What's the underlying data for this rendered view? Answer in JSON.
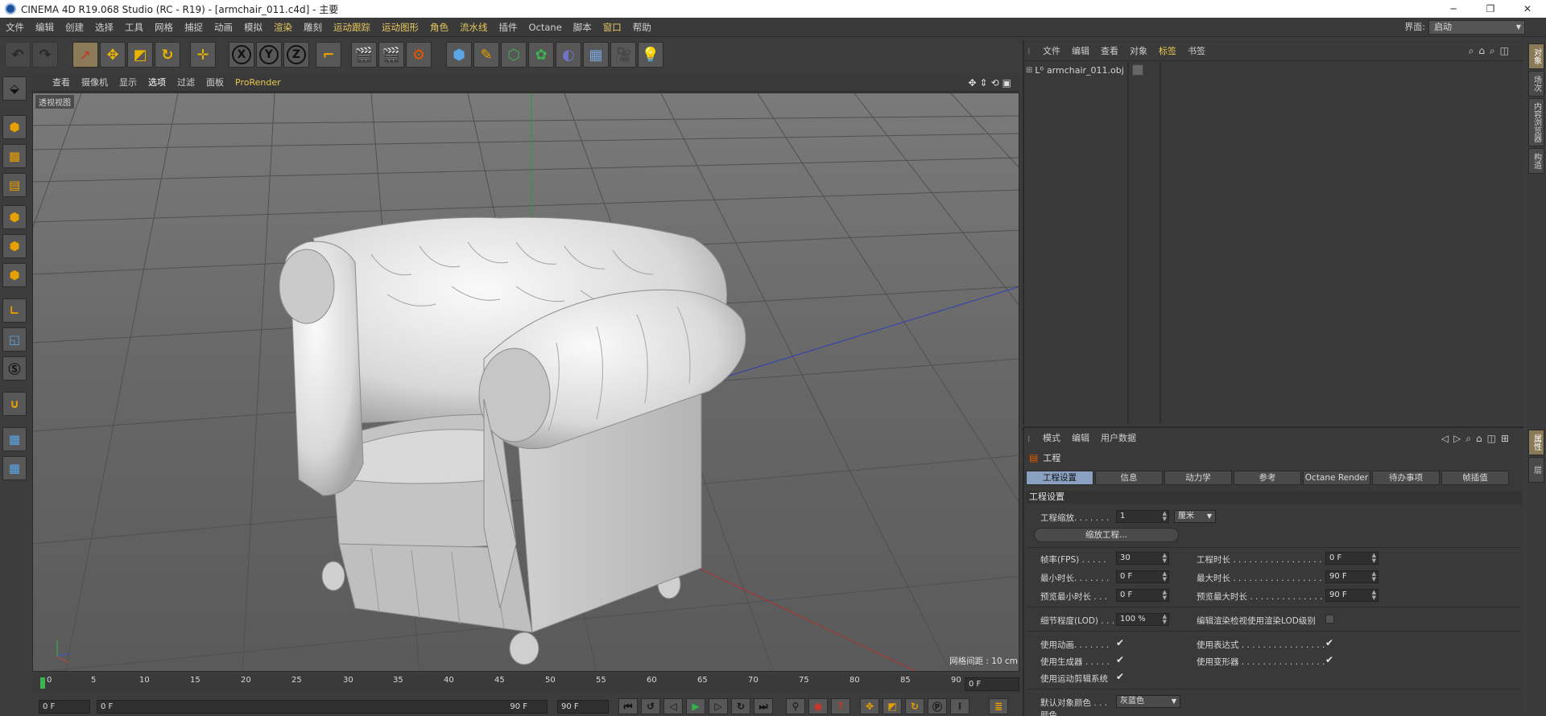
{
  "window": {
    "title": "CINEMA 4D R19.068 Studio (RC - R19) - [armchair_011.c4d] - 主要",
    "controls": [
      "─",
      "❐",
      "✕"
    ]
  },
  "menubar": {
    "items": [
      "文件",
      "编辑",
      "创建",
      "选择",
      "工具",
      "网格",
      "捕捉",
      "动画",
      "模拟",
      "渲染",
      "雕刻",
      "运动跟踪",
      "运动图形",
      "角色",
      "流水线",
      "插件",
      "Octane",
      "脚本",
      "窗口",
      "帮助"
    ],
    "layout_label": "界面:",
    "layout_value": "启动"
  },
  "toolbar": {
    "axis_x": "X",
    "axis_y": "Y",
    "axis_z": "Z"
  },
  "viewport": {
    "menu": [
      "查看",
      "摄像机",
      "显示",
      "选项",
      "过滤",
      "面板",
      "ProRender"
    ],
    "label": "透视视图",
    "grid_spacing": "网格间距 : 10 cm"
  },
  "timeline": {
    "ticks": [
      "0",
      "5",
      "10",
      "15",
      "20",
      "25",
      "30",
      "35",
      "40",
      "45",
      "50",
      "55",
      "60",
      "65",
      "70",
      "75",
      "80",
      "85",
      "90"
    ],
    "current_frame": "0 F",
    "start_field": "0 F",
    "range_start": "0 F",
    "range_end": "90 F",
    "end_field": "90 F"
  },
  "object_manager": {
    "menu": [
      "文件",
      "编辑",
      "查看",
      "对象",
      "标签",
      "书签"
    ],
    "objects": [
      {
        "name": "armchair_011.obj"
      }
    ]
  },
  "attribute_manager": {
    "menu": [
      "模式",
      "编辑",
      "用户数据"
    ],
    "title": "工程",
    "tabs": [
      "工程设置",
      "信息",
      "动力学",
      "参考",
      "Octane Render",
      "待办事项",
      "帧插值"
    ],
    "section": "工程设置",
    "scale_label": "工程缩放. . . . . . .",
    "scale_value": "1",
    "scale_unit": "厘米",
    "scale_button": "缩放工程...",
    "fps_label": "帧率(FPS) . . . . .",
    "fps_value": "30",
    "duration_label": "工程时长 . . . . . . . . . . . . . . . . . .",
    "duration_value": "0 F",
    "min_label": "最小时长. . . . . . .",
    "min_value": "0 F",
    "max_label": "最大时长 . . . . . . . . . . . . . . . . . .",
    "max_value": "90 F",
    "pmin_label": "预览最小时长 . . .",
    "pmin_value": "0 F",
    "pmax_label": "预览最大时长 . . . . . . . . . . . . . . .",
    "pmax_value": "90 F",
    "lod_label": "细节程度(LOD) . . .",
    "lod_value": "100 %",
    "lod_check_label": "编辑渲染检视使用渲染LOD级别",
    "use_anim_label": "使用动画. . . . . . .",
    "use_expr_label": "使用表达式 . . . . . . . . . . . . . . . .",
    "use_gen_label": "使用生成器 . . . . .",
    "use_deform_label": "使用变形器 . . . . . . . . . . . . . . . .",
    "use_motion_label": "使用运动剪辑系统",
    "def_color_label": "默认对象颜色 . . .",
    "def_color_value": "灰蓝色",
    "color_label": "颜色"
  },
  "right_tabs": [
    "对象",
    "场次",
    "内容浏览器",
    "构造",
    "属性",
    "层"
  ]
}
